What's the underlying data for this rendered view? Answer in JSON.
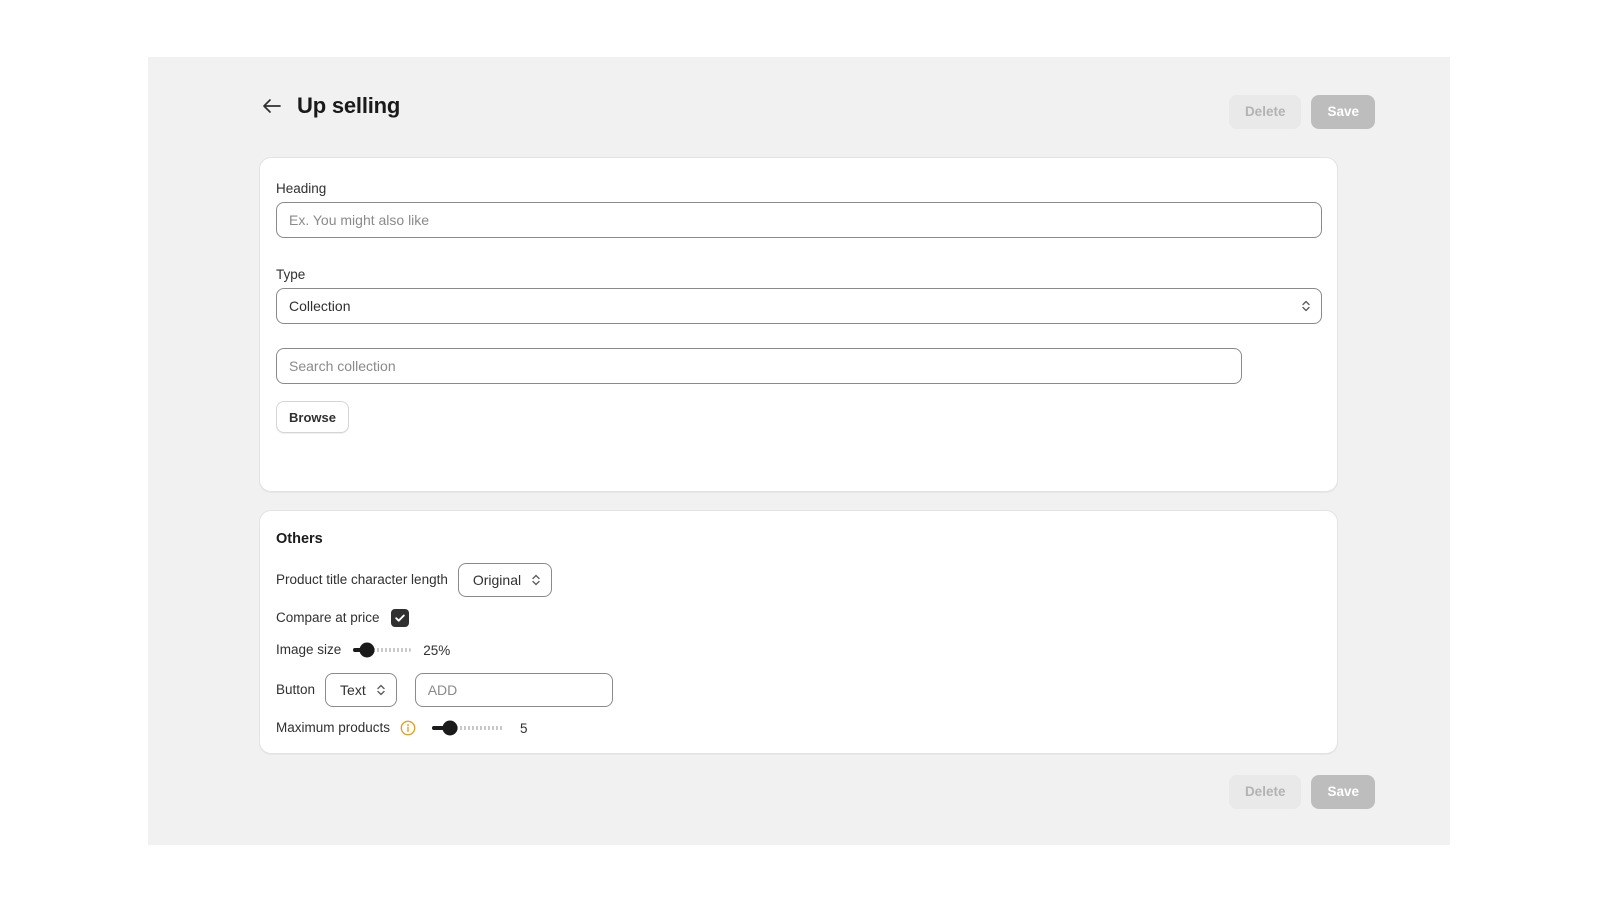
{
  "header": {
    "back_icon": "arrow-left-icon",
    "title": "Up selling",
    "delete_label": "Delete",
    "save_label": "Save"
  },
  "main_card": {
    "heading_label": "Heading",
    "heading_placeholder": "Ex. You might also like",
    "heading_value": "",
    "type_label": "Type",
    "type_value": "Collection",
    "type_caret_icon": "chevron-up-down-icon",
    "search_placeholder": "Search collection",
    "search_value": "",
    "browse_label": "Browse"
  },
  "others_card": {
    "title": "Others",
    "product_title_length_label": "Product title character length",
    "product_title_length_value": "Original",
    "product_title_length_caret_icon": "chevron-up-down-icon",
    "compare_at_price_label": "Compare at price",
    "compare_at_price_checked": "true",
    "check_icon": "check-icon",
    "image_size_label": "Image size",
    "image_size_value": "25%",
    "image_size_percent": 25,
    "button_label": "Button",
    "button_type_value": "Text",
    "button_type_caret_icon": "chevron-up-down-icon",
    "button_text_value": "ADD",
    "button_text_placeholder": "ADD",
    "maximum_products_label": "Maximum products",
    "maximum_products_info_icon": "info-circle-icon",
    "maximum_products_value": "5",
    "maximum_products_percent": 16
  },
  "footer": {
    "delete_label": "Delete",
    "save_label": "Save"
  },
  "colors": {
    "stage_bg": "#f1f1f1",
    "card_bg": "#ffffff",
    "text": "#303030",
    "accent_info": "#e0a325",
    "save_bg": "#bdbdbd",
    "delete_bg": "#e9e9e9"
  }
}
